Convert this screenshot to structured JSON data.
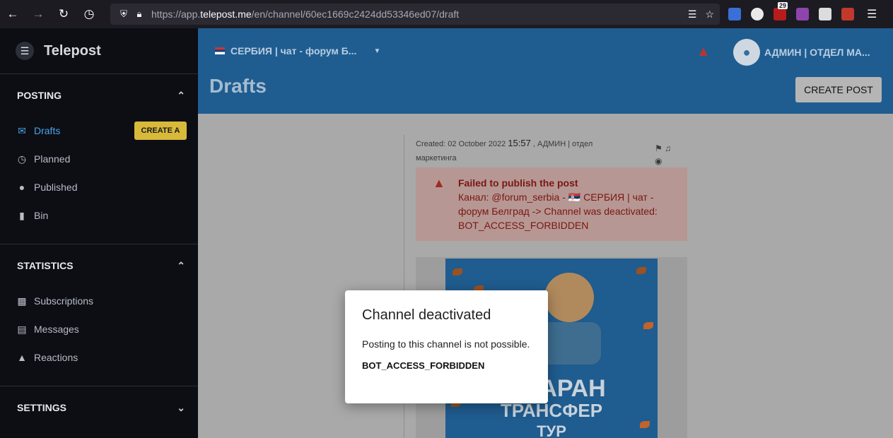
{
  "browser": {
    "url_prefix": "https://app.",
    "url_domain": "telepost.me",
    "url_suffix": "/en/channel/60ec1669c2424dd53346ed07/draft",
    "extension_badge": "29",
    "icons": [
      "back-arrow-icon",
      "forward-arrow-icon",
      "reload-icon",
      "history-icon",
      "shield-icon",
      "lock-icon",
      "reader-icon",
      "star-icon",
      "hamburger-icon"
    ]
  },
  "brand": {
    "name": "Telepost"
  },
  "sidebar": {
    "posting": {
      "header": "POSTING",
      "items": [
        {
          "label": "Drafts",
          "icon": "inbox-icon",
          "active": true
        },
        {
          "label": "Planned",
          "icon": "alarm-clock-icon"
        },
        {
          "label": "Published",
          "icon": "globe-icon"
        },
        {
          "label": "Bin",
          "icon": "trash-icon"
        }
      ],
      "create_badge": "CREATE A"
    },
    "statistics": {
      "header": "STATISTICS",
      "items": [
        {
          "label": "Subscriptions",
          "icon": "bar-chart-icon"
        },
        {
          "label": "Messages",
          "icon": "message-icon"
        },
        {
          "label": "Reactions",
          "icon": "thumbs-up-icon"
        }
      ]
    },
    "settings": {
      "header": "SETTINGS"
    }
  },
  "topbar": {
    "channel": "СЕРБИЯ | чат - форум Б...",
    "user": "АДМИН | ОТДЕЛ МА...",
    "page_title": "Drafts",
    "create_post": "CREATE POST"
  },
  "post": {
    "created_prefix": "Created: 02 October 2022",
    "created_time": "15:57",
    "created_author": ", АДМИН | отдел маркетинга",
    "error_title": "Failed to publish the post",
    "error_text": "Канал: @forum_serbia - 🇷🇸 СЕРБИЯ | чат - форум Белград -> Channel was deactivated: BOT_ACCESS_FORBIDDEN",
    "image_text_line1": "АРАН",
    "image_text_line2": "ТРАНСФЕР",
    "image_text_line3": "ТУР"
  },
  "modal": {
    "title": "Channel deactivated",
    "text": "Posting to this channel is not possible.",
    "code": "BOT_ACCESS_FORBIDDEN"
  },
  "colors": {
    "sidebar_bg": "#0c0e14",
    "topbar_bg": "#1f5d91",
    "active_item": "#4aa3e8",
    "create_badge": "#d8b93a",
    "error_text": "#7a1712"
  }
}
